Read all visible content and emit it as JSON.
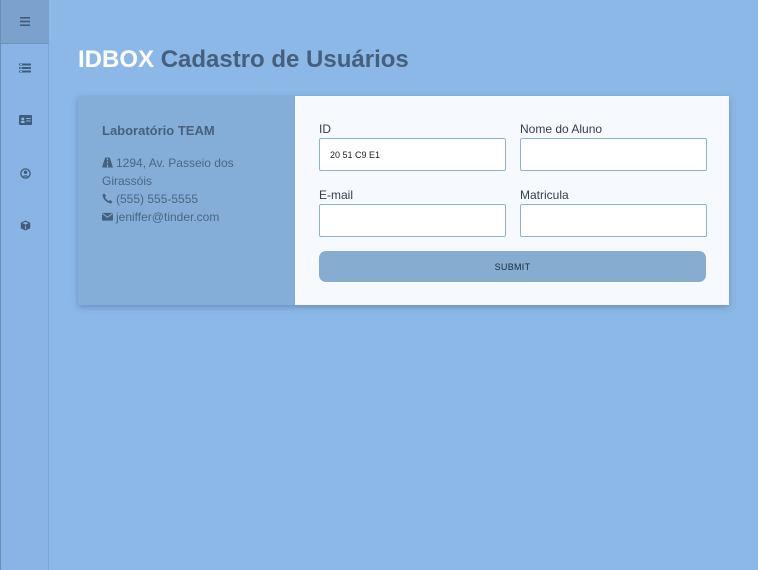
{
  "sidebar": {
    "items": [
      {
        "icon": "menu-icon"
      },
      {
        "icon": "list-icon"
      },
      {
        "icon": "id-card-icon"
      },
      {
        "icon": "user-circle-icon"
      },
      {
        "icon": "cube-icon"
      }
    ]
  },
  "header": {
    "brand": "IDBOX",
    "title": "Cadastro de Usuários"
  },
  "info": {
    "title": "Laboratório TEAM",
    "address": "1294, Av. Passeio dos Girassóis",
    "phone": "(555) 555-5555",
    "email": "jeniffer@tinder.com"
  },
  "form": {
    "id_label": "ID",
    "id_value": "20 51 C9 E1",
    "name_label": "Nome do Aluno",
    "name_value": "",
    "email_label": "E-mail",
    "email_value": "",
    "matricula_label": "Matricula",
    "matricula_value": "",
    "submit_label": "SUBMIT"
  },
  "colors": {
    "background": "#8cb8e8",
    "sidebar": "#89b4e3",
    "info_panel": "#84aed8",
    "form_panel": "#f6fafe",
    "submit": "#86acd0",
    "title_text": "#44607f"
  }
}
